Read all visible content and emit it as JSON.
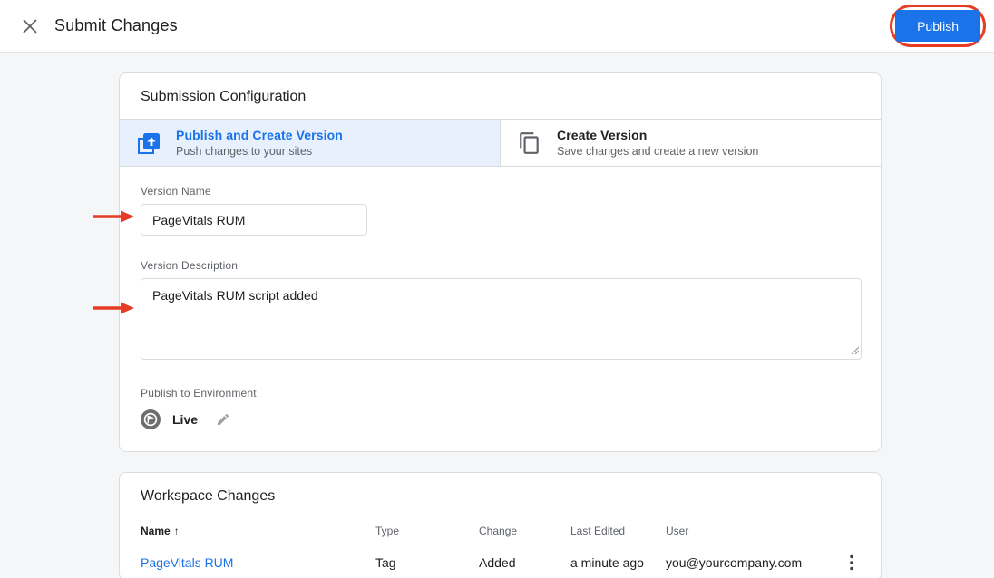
{
  "header": {
    "title": "Submit Changes",
    "publish_label": "Publish"
  },
  "submission": {
    "title": "Submission Configuration",
    "options": [
      {
        "title": "Publish and Create Version",
        "subtitle": "Push changes to your sites",
        "selected": true,
        "icon": "publish-icon"
      },
      {
        "title": "Create Version",
        "subtitle": "Save changes and create a new version",
        "selected": false,
        "icon": "copy-icon"
      }
    ],
    "version_name": {
      "label": "Version Name",
      "value": "PageVitals RUM"
    },
    "version_description": {
      "label": "Version Description",
      "value": "PageVitals RUM script added"
    },
    "environment": {
      "label": "Publish to Environment",
      "value": "Live"
    }
  },
  "workspace": {
    "title": "Workspace Changes",
    "columns": [
      "Name",
      "Type",
      "Change",
      "Last Edited",
      "User"
    ],
    "sort_icon": "↑",
    "rows": [
      {
        "name": "PageVitals RUM",
        "type": "Tag",
        "change": "Added",
        "last_edited": "a minute ago",
        "user": "you@yourcompany.com"
      }
    ]
  },
  "annotations": {
    "color": "#e63c25",
    "highlighted_element": "publish-button",
    "arrow_targets": [
      "version-name-input",
      "version-description-textarea"
    ]
  },
  "colors": {
    "accent_blue": "#1a73e8",
    "selected_tile_bg": "#e8f0fe",
    "text_primary": "#202124",
    "text_secondary": "#5f6368",
    "border": "#dadce0",
    "annotation_red": "#e63c25"
  }
}
